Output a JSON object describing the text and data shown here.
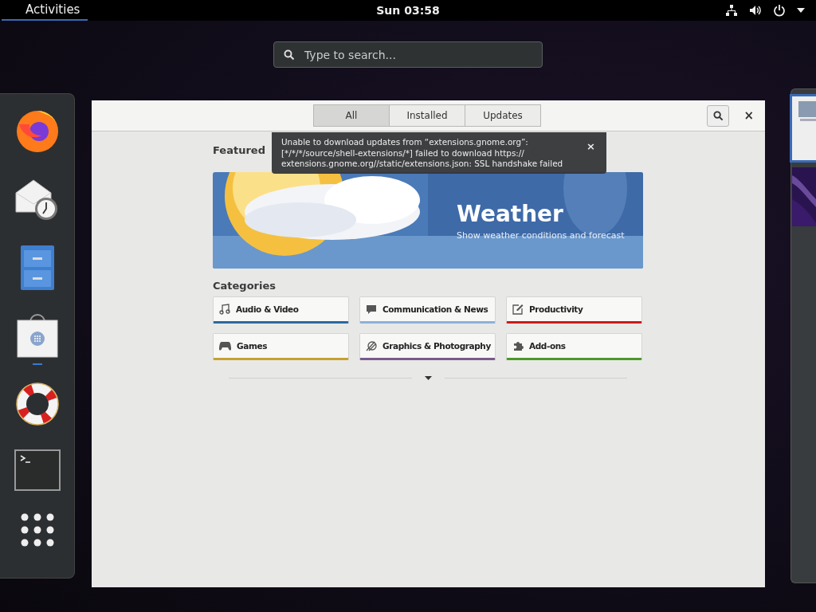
{
  "top_bar": {
    "activities": "Activities",
    "clock": "Sun 03:58"
  },
  "search": {
    "placeholder": "Type to search..."
  },
  "dock": [
    {
      "kind": "browser",
      "running": false
    },
    {
      "kind": "mail",
      "running": false
    },
    {
      "kind": "files",
      "running": false
    },
    {
      "kind": "software",
      "running": true
    },
    {
      "kind": "help",
      "running": false
    },
    {
      "kind": "terminal",
      "running": false
    },
    {
      "kind": "apps",
      "running": false
    }
  ],
  "window": {
    "tabs": [
      {
        "label": "All",
        "selected": true
      },
      {
        "label": "Installed",
        "selected": false
      },
      {
        "label": "Updates",
        "selected": false
      }
    ],
    "notification": {
      "message": "Unable to download updates from “extensions.gnome.org”: [*/*/*/source/shell-extensions/*] failed to download https:// extensions.gnome.org//static/extensions.json: SSL handshake failed",
      "close": "×"
    },
    "close": "×",
    "featured_heading": "Featured",
    "banner": {
      "title": "Weather",
      "subtitle": "Show weather conditions and forecast"
    },
    "categories_heading": "Categories",
    "categories": [
      {
        "label": "Audio & Video",
        "kind": "music",
        "color": "#2a6aa0"
      },
      {
        "label": "Communication & News",
        "kind": "chat",
        "color": "#8fb0d8"
      },
      {
        "label": "Productivity",
        "kind": "edit",
        "color": "#cc1a1a"
      },
      {
        "label": "Games",
        "kind": "gamepad",
        "color": "#c8a030"
      },
      {
        "label": "Graphics & Photography",
        "kind": "graphics",
        "color": "#7a5a8a"
      },
      {
        "label": "Add-ons",
        "kind": "puzzle",
        "color": "#4a9a2a"
      }
    ]
  }
}
